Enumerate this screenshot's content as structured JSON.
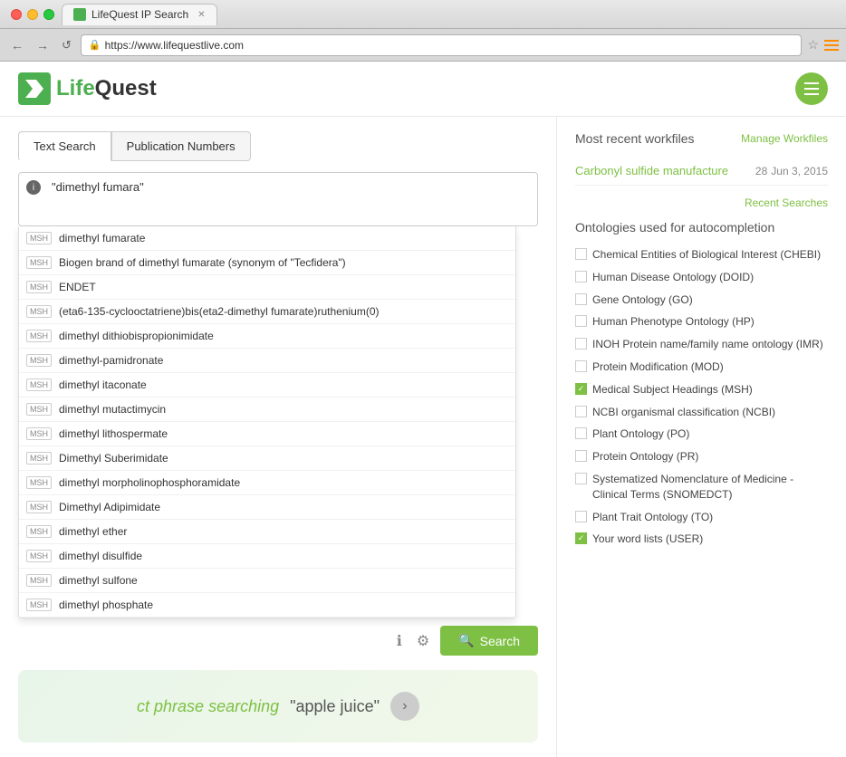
{
  "browser": {
    "tab_title": "LifeQuest IP Search",
    "url": "https://www.lifequestlive.com",
    "back_btn": "←",
    "forward_btn": "→",
    "reload_btn": "↺"
  },
  "header": {
    "logo_text_prefix": "Life",
    "logo_text_suffix": "Quest",
    "hamburger_label": "menu"
  },
  "search": {
    "tab_text": "Text Search",
    "tab_publication": "Publication Numbers",
    "info_icon": "i",
    "query": "\"dimethyl fumara\"",
    "search_btn": "Search",
    "info_btn_label": "info",
    "settings_btn_label": "settings"
  },
  "autocomplete": {
    "items": [
      {
        "badge": "MSH",
        "text": "dimethyl fumarate"
      },
      {
        "badge": "MSH",
        "text": "Biogen brand of dimethyl fumarate (synonym of \"Tecfidera\")"
      },
      {
        "badge": "MSH",
        "text": "ENDET"
      },
      {
        "badge": "MSH",
        "text": "(eta6-135-cyclooctatriene)bis(eta2-dimethyl fumarate)ruthenium(0)"
      },
      {
        "badge": "MSH",
        "text": "dimethyl dithiobispropionimidate"
      },
      {
        "badge": "MSH",
        "text": "dimethyl-pamidronate"
      },
      {
        "badge": "MSH",
        "text": "dimethyl itaconate"
      },
      {
        "badge": "MSH",
        "text": "dimethyl mutactimycin"
      },
      {
        "badge": "MSH",
        "text": "dimethyl lithospermate"
      },
      {
        "badge": "MSH",
        "text": "Dimethyl Suberimidate"
      },
      {
        "badge": "MSH",
        "text": "dimethyl morpholinophosphoramidate"
      },
      {
        "badge": "MSH",
        "text": "Dimethyl Adipimidate"
      },
      {
        "badge": "MSH",
        "text": "dimethyl ether"
      },
      {
        "badge": "MSH",
        "text": "dimethyl disulfide"
      },
      {
        "badge": "MSH",
        "text": "dimethyl sulfone"
      },
      {
        "badge": "MSH",
        "text": "dimethyl phosphate"
      }
    ]
  },
  "phrase_area": {
    "text": "ct phrase searching",
    "example": "\"apple juice\""
  },
  "workfiles": {
    "title": "Most recent workfiles",
    "manage_link": "Manage Workfiles",
    "items": [
      {
        "name": "Carbonyl sulfide manufacture",
        "count": "28",
        "date": "Jun 3, 2015"
      }
    ]
  },
  "recent_searches": {
    "label": "Recent Searches"
  },
  "ontologies": {
    "title": "Ontologies used for autocompletion",
    "items": [
      {
        "label": "Chemical Entities of Biological Interest (CHEBI)",
        "checked": false
      },
      {
        "label": "Human Disease Ontology (DOID)",
        "checked": false
      },
      {
        "label": "Gene Ontology (GO)",
        "checked": false
      },
      {
        "label": "Human Phenotype Ontology (HP)",
        "checked": false
      },
      {
        "label": "INOH Protein name/family name ontology (IMR)",
        "checked": false
      },
      {
        "label": "Protein Modification (MOD)",
        "checked": false
      },
      {
        "label": "Medical Subject Headings (MSH)",
        "checked": true
      },
      {
        "label": "NCBI organismal classification (NCBI)",
        "checked": false
      },
      {
        "label": "Plant Ontology (PO)",
        "checked": false
      },
      {
        "label": "Protein Ontology (PR)",
        "checked": false
      },
      {
        "label": "Systematized Nomenclature of Medicine - Clinical Terms (SNOMEDCT)",
        "checked": false
      },
      {
        "label": "Plant Trait Ontology (TO)",
        "checked": false
      },
      {
        "label": "Your word lists (USER)",
        "checked": true
      }
    ]
  }
}
